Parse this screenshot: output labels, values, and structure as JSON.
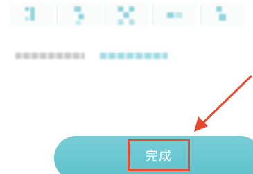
{
  "verification_code": {
    "digits": [
      "",
      "",
      "",
      "",
      ""
    ],
    "accent_color": "#8fd3d9"
  },
  "hint": {
    "text": "",
    "link_text": ""
  },
  "done_button": {
    "label": "完成",
    "color": "#5ec1cb",
    "highlight_color": "#e8492f"
  },
  "annotation": {
    "arrow_color": "#e8492f"
  }
}
